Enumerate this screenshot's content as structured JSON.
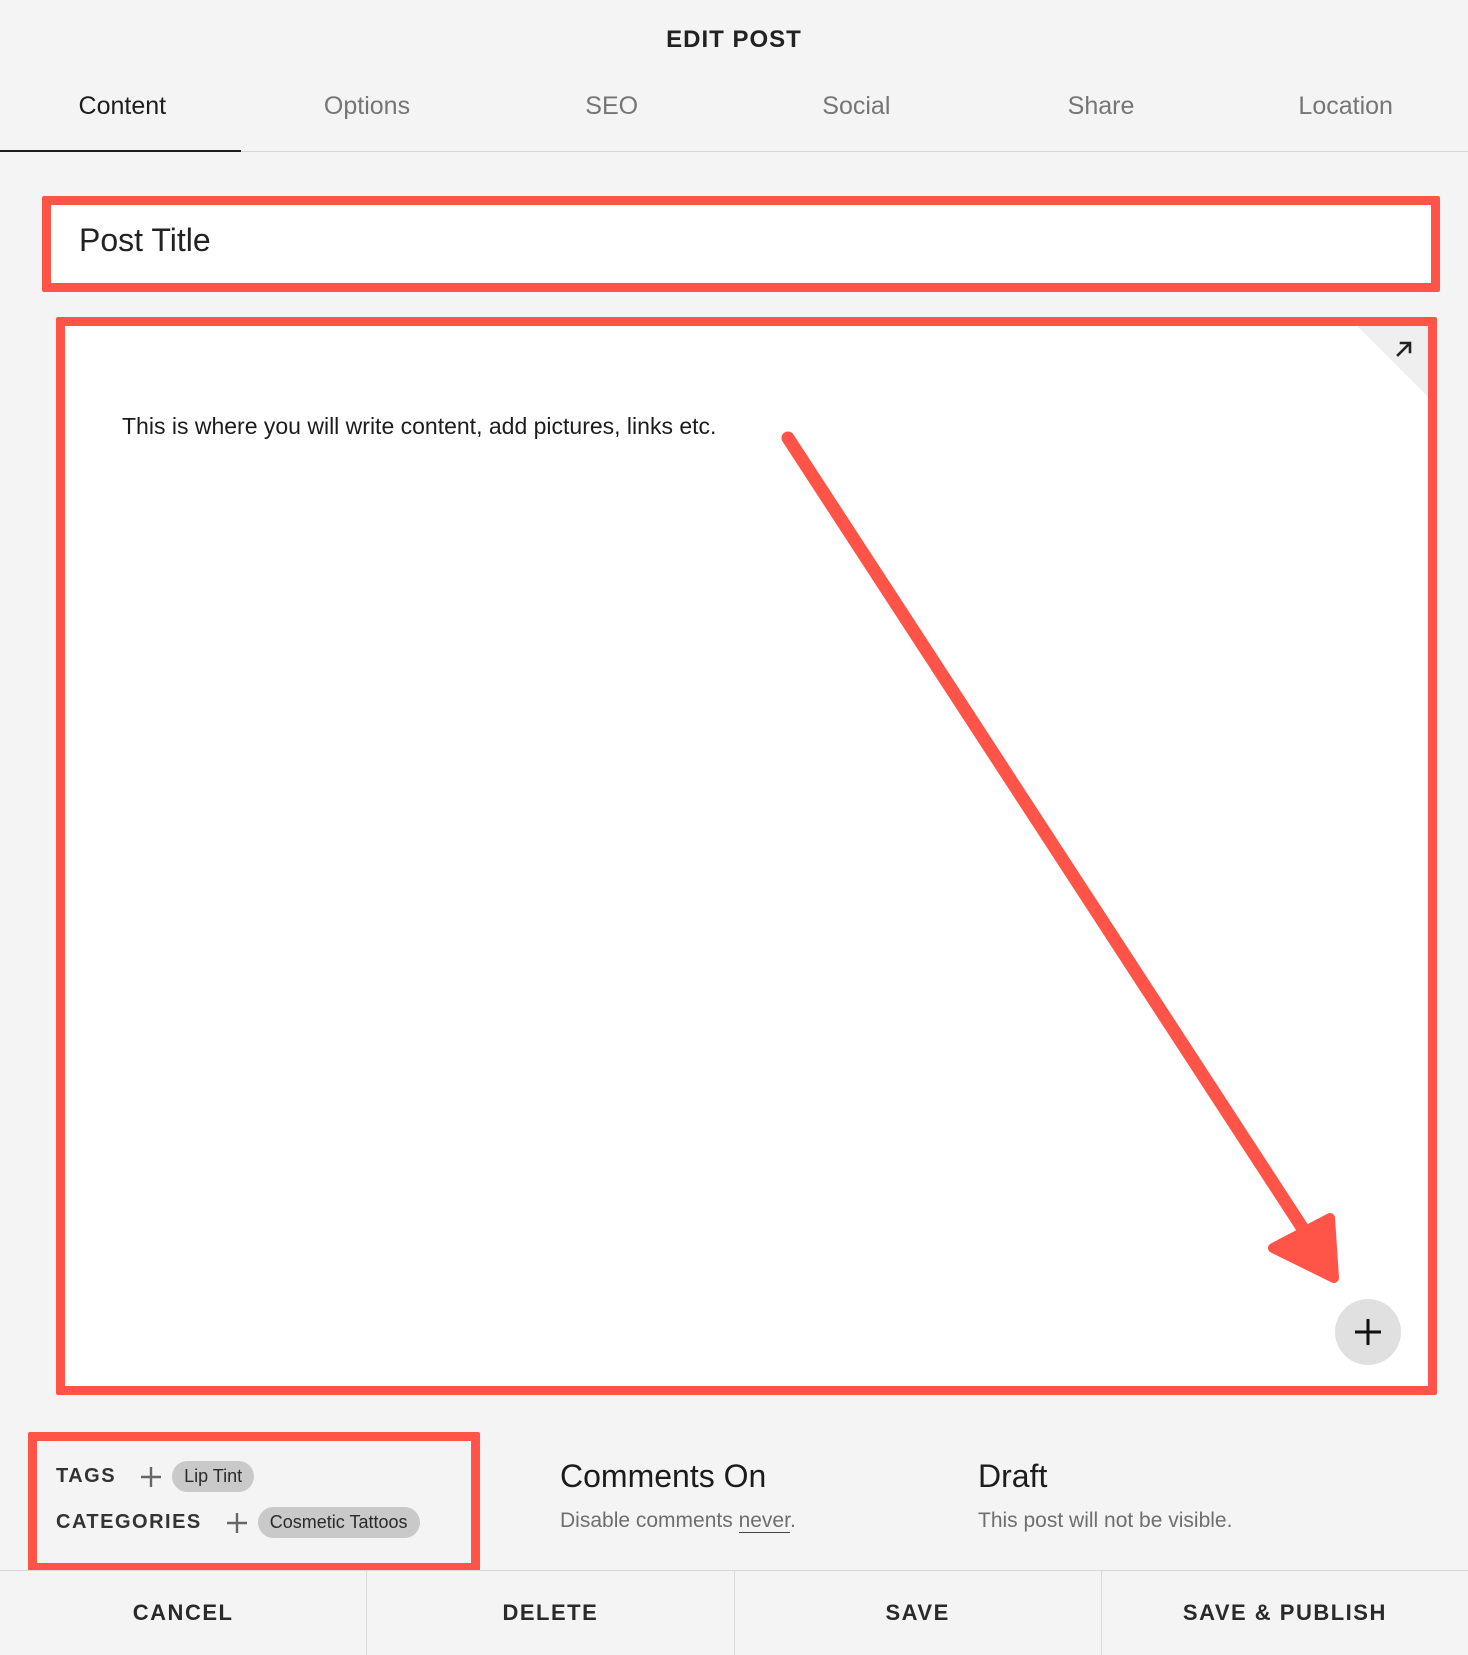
{
  "header": {
    "title": "EDIT POST"
  },
  "tabs": [
    {
      "label": "Content",
      "active": true
    },
    {
      "label": "Options"
    },
    {
      "label": "SEO"
    },
    {
      "label": "Social"
    },
    {
      "label": "Share"
    },
    {
      "label": "Location"
    }
  ],
  "post": {
    "title_placeholder": "Post Title",
    "body_text": "This is where you will write content, add pictures, links etc."
  },
  "editor": {
    "expand_icon": "expand-arrow-icon",
    "add_icon": "plus-icon"
  },
  "tags": {
    "label": "TAGS",
    "items": [
      "Lip Tint"
    ]
  },
  "categories": {
    "label": "CATEGORIES",
    "items": [
      "Cosmetic Tattoos"
    ]
  },
  "comments": {
    "title": "Comments On",
    "sub_prefix": "Disable comments ",
    "sub_link": "never",
    "sub_suffix": "."
  },
  "status": {
    "title": "Draft",
    "sub": "This post will not be visible."
  },
  "footer": {
    "cancel": "CANCEL",
    "delete": "DELETE",
    "save": "SAVE",
    "save_publish": "SAVE & PUBLISH"
  },
  "colors": {
    "annotation": "#ff5447",
    "background": "#f4f4f4",
    "chip": "#c9c9c9"
  }
}
